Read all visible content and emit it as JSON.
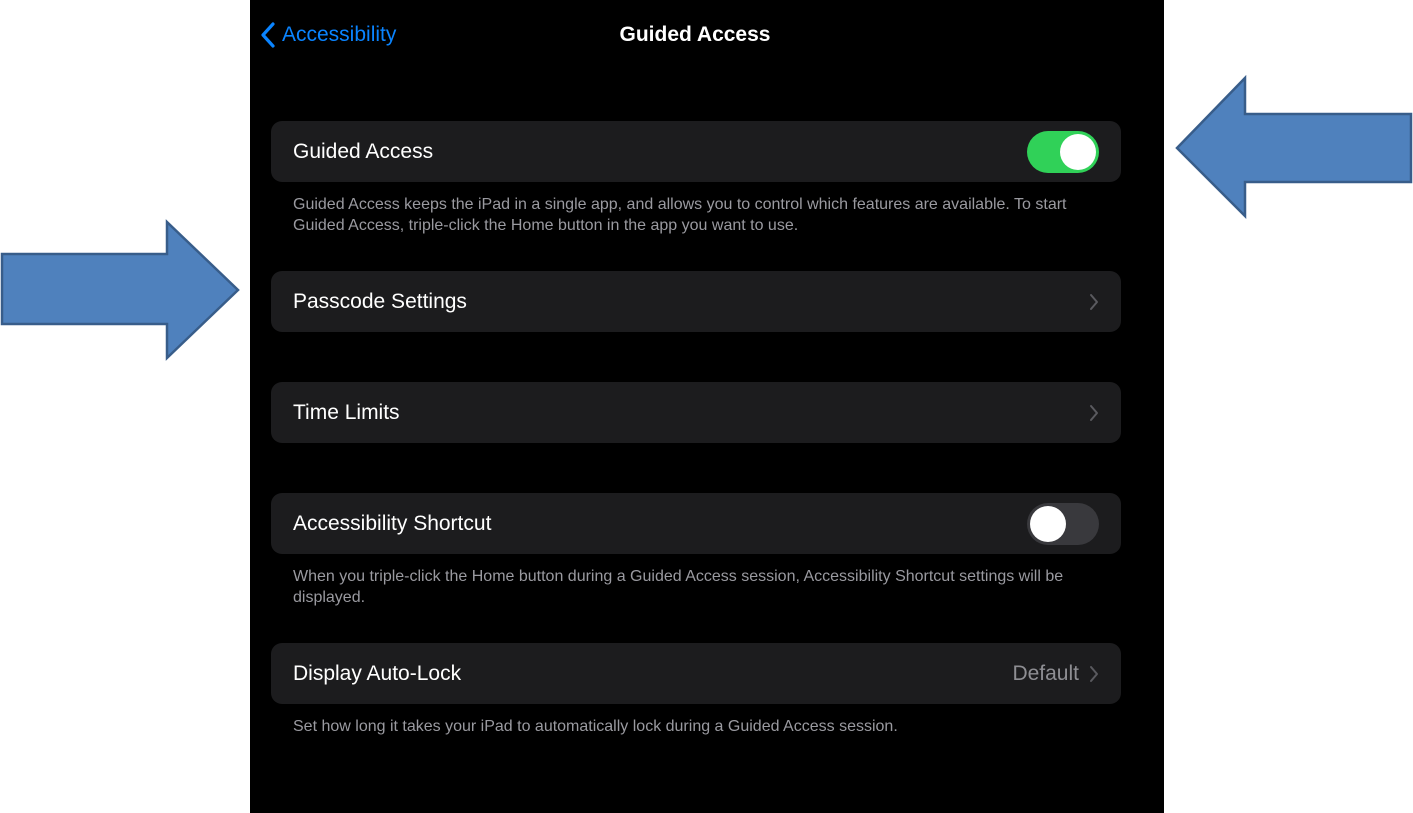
{
  "navbar": {
    "back_label": "Accessibility",
    "title": "Guided Access"
  },
  "rows": {
    "guided_access": {
      "label": "Guided Access",
      "toggle": "on",
      "footer": "Guided Access keeps the iPad in a single app, and allows you to control which features are available. To start Guided Access, triple-click the Home button in the app you want to use."
    },
    "passcode_settings": {
      "label": "Passcode Settings"
    },
    "time_limits": {
      "label": "Time Limits"
    },
    "accessibility_shortcut": {
      "label": "Accessibility Shortcut",
      "toggle": "off",
      "footer": "When you triple-click the Home button during a Guided Access session, Accessibility Shortcut settings will be displayed."
    },
    "display_auto_lock": {
      "label": "Display Auto-Lock",
      "value": "Default",
      "footer": "Set how long it takes your iPad to automatically lock during a Guided Access session."
    }
  },
  "colors": {
    "background": "#000000",
    "cell": "#1c1c1e",
    "accent": "#0a84ff",
    "toggle_on": "#30d158",
    "toggle_off": "#39393d",
    "arrow_fill": "#4f81bd",
    "arrow_stroke": "#385d8a"
  },
  "icons": {
    "back": "chevron-left-icon",
    "disclosure": "chevron-right-icon",
    "callouts": "arrow-callout"
  }
}
